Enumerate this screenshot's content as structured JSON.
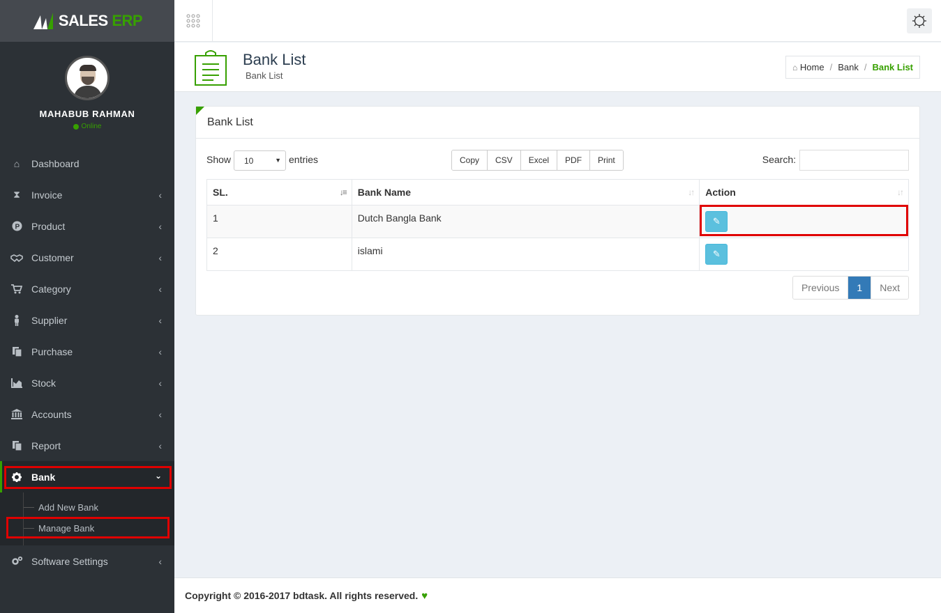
{
  "brand": {
    "name_part1": "SALES",
    "name_part2": "ERP",
    "accent_color": "#37a000"
  },
  "user": {
    "name": "MAHABUB RAHMAN",
    "status": "Online"
  },
  "sidebar": {
    "items": [
      {
        "label": "Dashboard",
        "icon": "home-icon"
      },
      {
        "label": "Invoice",
        "icon": "hourglass-icon"
      },
      {
        "label": "Product",
        "icon": "product-icon"
      },
      {
        "label": "Customer",
        "icon": "handshake-icon"
      },
      {
        "label": "Category",
        "icon": "cart-icon"
      },
      {
        "label": "Supplier",
        "icon": "person-icon"
      },
      {
        "label": "Purchase",
        "icon": "copy-icon"
      },
      {
        "label": "Stock",
        "icon": "chart-icon"
      },
      {
        "label": "Accounts",
        "icon": "bank-icon"
      },
      {
        "label": "Report",
        "icon": "report-icon"
      },
      {
        "label": "Bank",
        "icon": "gear-icon"
      },
      {
        "label": "Software Settings",
        "icon": "gears-icon"
      }
    ],
    "bank_submenu": [
      "Add New Bank",
      "Manage Bank"
    ]
  },
  "page": {
    "title": "Bank List",
    "subtitle": "Bank List",
    "breadcrumb": [
      "Home",
      "Bank",
      "Bank List"
    ]
  },
  "panel": {
    "title": "Bank List",
    "show_label": "Show",
    "entries_value": "10",
    "entries_label": "entries",
    "export_buttons": [
      "Copy",
      "CSV",
      "Excel",
      "PDF",
      "Print"
    ],
    "search_label": "Search:",
    "search_value": ""
  },
  "table": {
    "columns": [
      "SL.",
      "Bank Name",
      "Action"
    ],
    "rows": [
      {
        "sl": "1",
        "name": "Dutch Bangla Bank"
      },
      {
        "sl": "2",
        "name": "islami"
      }
    ]
  },
  "pagination": {
    "previous": "Previous",
    "current": "1",
    "next": "Next"
  },
  "footer": {
    "text": "Copyright © 2016-2017 bdtask. All rights reserved."
  }
}
